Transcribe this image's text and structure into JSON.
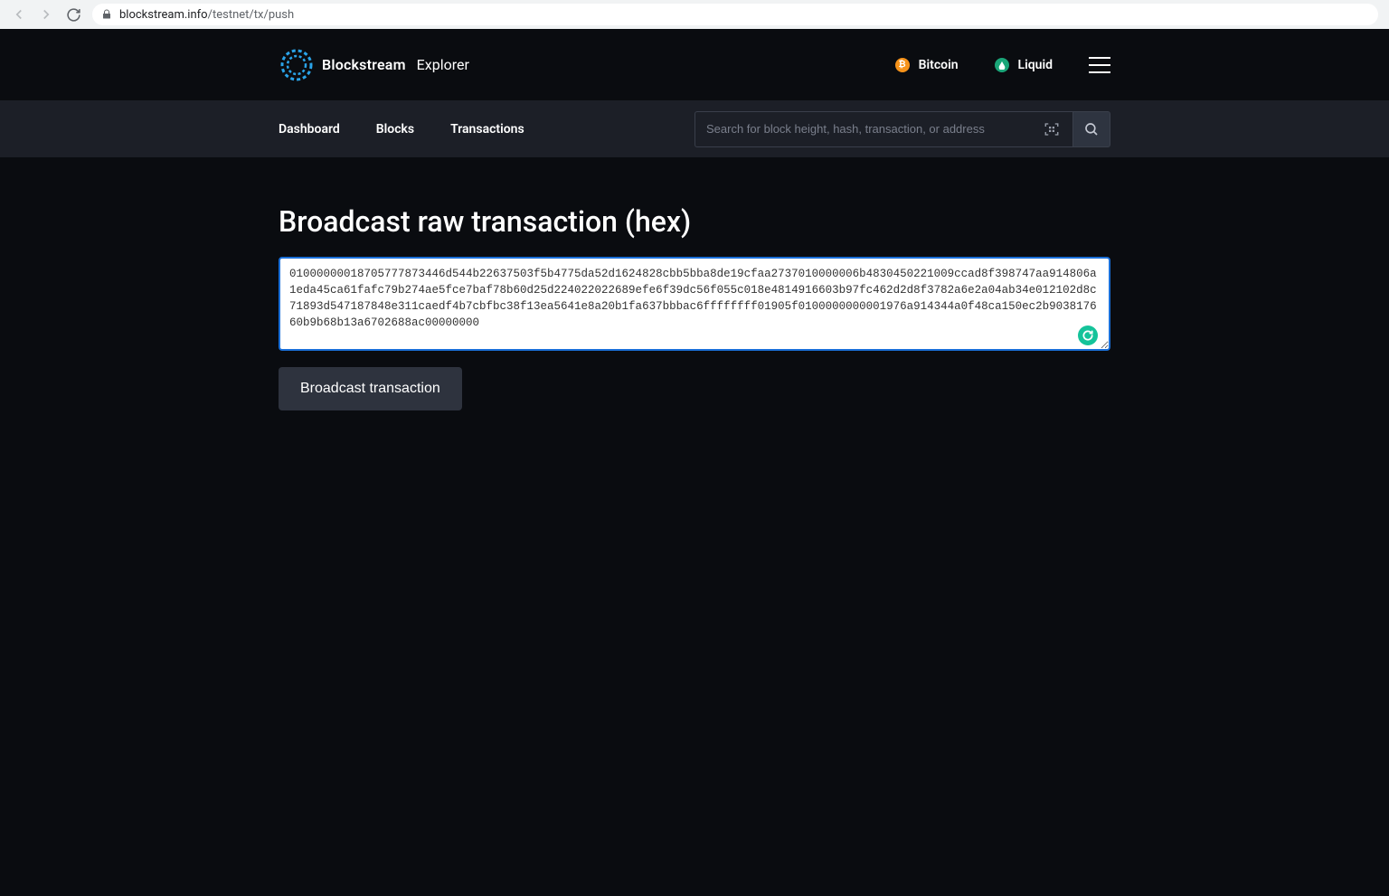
{
  "browser": {
    "host": "blockstream.info",
    "path": "/testnet/tx/push"
  },
  "header": {
    "brand_name": "Blockstream",
    "brand_sub": "Explorer",
    "networks": [
      {
        "label": "Bitcoin",
        "dot": "₿"
      },
      {
        "label": "Liquid",
        "dot": "💧"
      }
    ]
  },
  "subnav": {
    "links": [
      "Dashboard",
      "Blocks",
      "Transactions"
    ],
    "search_placeholder": "Search for block height, hash, transaction, or address"
  },
  "main": {
    "title": "Broadcast raw transaction (hex)",
    "tx_hex": "01000000018705777873446d544b22637503f5b4775da52d1624828cbb5bba8de19cfaa2737010000006b4830450221009ccad8f398747aa914806a1eda45ca61fafc79b274ae5fce7baf78b60d25d224022022689efe6f39dc56f055c018e4814916603b97fc462d2d8f3782a6e2a04ab34e012102d8c71893d547187848e311caedf4b7cbfbc38f13ea5641e8a20b1fa637bbbac6ffffffff01905f0100000000001976a914344a0f48ca150ec2b903817660b9b68b13a6702688ac00000000",
    "button_label": "Broadcast transaction"
  }
}
